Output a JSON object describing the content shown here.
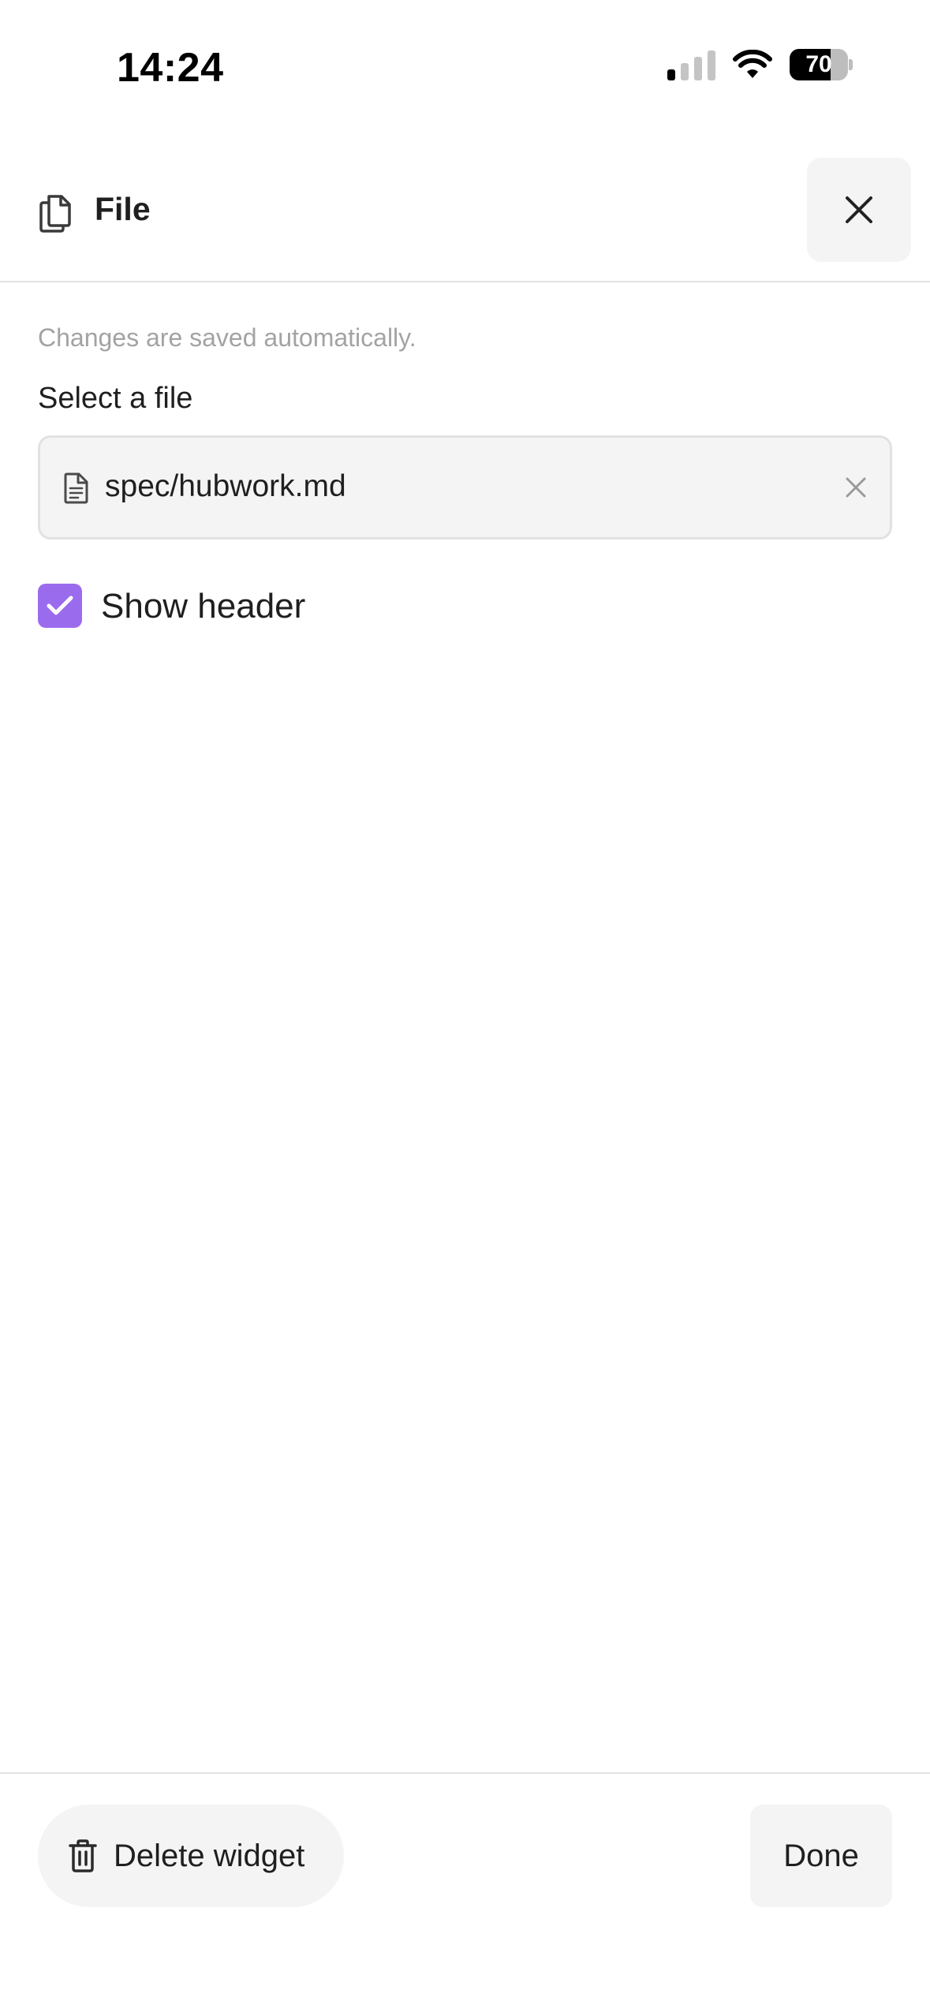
{
  "status_bar": {
    "time": "14:24",
    "battery_percent": "70",
    "battery_level": 0.7,
    "icons": [
      "signal-icon",
      "wifi-icon",
      "battery-icon"
    ]
  },
  "header": {
    "title": "File",
    "icon": "file-copy-icon",
    "close_icon": "close-icon"
  },
  "form": {
    "hint": "Changes are saved automatically.",
    "file_label": "Select a file",
    "file_value": "spec/hubwork.md",
    "file_icon": "document-icon",
    "clear_icon": "clear-icon",
    "show_header_label": "Show header",
    "show_header_checked": true
  },
  "footer": {
    "delete_label": "Delete widget",
    "delete_icon": "trash-icon",
    "done_label": "Done"
  },
  "colors": {
    "accent": "#9b6bee",
    "surface": "#f4f4f4",
    "divider": "#e3e3e3",
    "muted_text": "#a3a3a3"
  }
}
